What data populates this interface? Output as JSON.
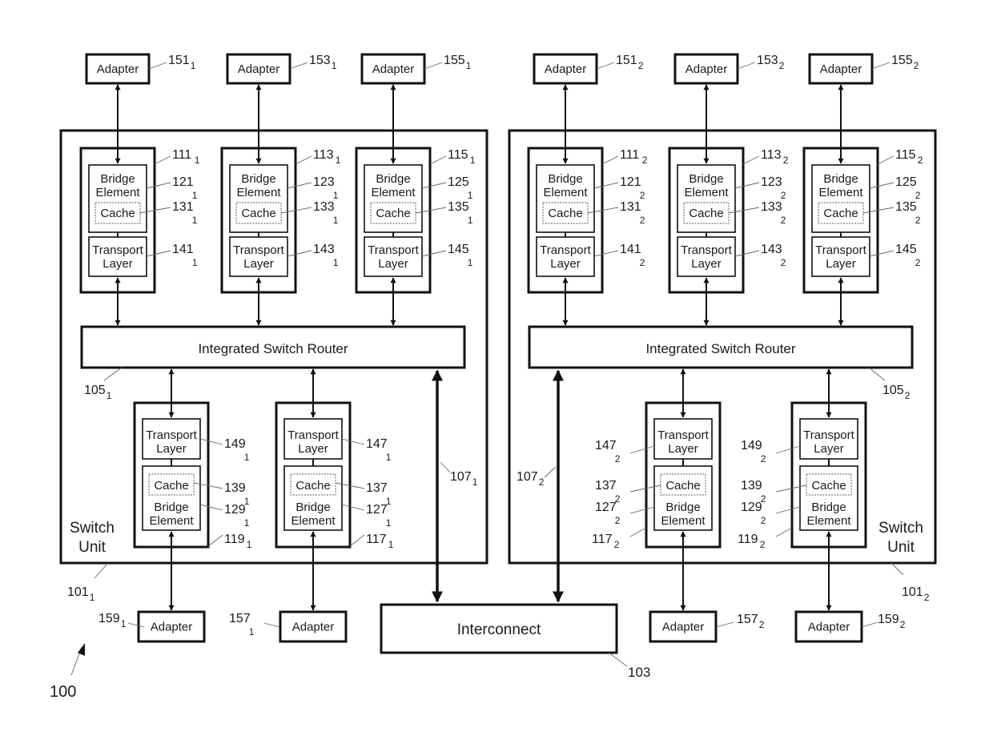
{
  "figure": {
    "figure_number": "100",
    "interconnect": {
      "label": "Interconnect",
      "ref": "103"
    },
    "switch_units": [
      {
        "id": "1",
        "label_line1": "Switch",
        "label_line2": "Unit",
        "ref": "101",
        "ref_sub": "1",
        "router": {
          "label": "Integrated Switch Router",
          "ref": "105",
          "ref_sub": "1"
        },
        "interconnect_link": {
          "ref": "107",
          "ref_sub": "1"
        },
        "top_modules": [
          {
            "module_ref": "111",
            "bridge_ref": "121",
            "cache_ref": "131",
            "transport_ref": "141",
            "adapter_ref": "151",
            "sub": "1"
          },
          {
            "module_ref": "113",
            "bridge_ref": "123",
            "cache_ref": "133",
            "transport_ref": "143",
            "adapter_ref": "153",
            "sub": "1"
          },
          {
            "module_ref": "115",
            "bridge_ref": "125",
            "cache_ref": "135",
            "transport_ref": "145",
            "adapter_ref": "155",
            "sub": "1"
          }
        ],
        "bottom_modules": [
          {
            "module_ref": "119",
            "bridge_ref": "129",
            "cache_ref": "139",
            "transport_ref": "149",
            "adapter_ref": "159",
            "sub": "1"
          },
          {
            "module_ref": "117",
            "bridge_ref": "127",
            "cache_ref": "137",
            "transport_ref": "147",
            "adapter_ref": "157",
            "sub": "1"
          }
        ]
      },
      {
        "id": "2",
        "label_line1": "Switch",
        "label_line2": "Unit",
        "ref": "101",
        "ref_sub": "2",
        "router": {
          "label": "Integrated Switch Router",
          "ref": "105",
          "ref_sub": "2"
        },
        "interconnect_link": {
          "ref": "107",
          "ref_sub": "2"
        },
        "top_modules": [
          {
            "module_ref": "111",
            "bridge_ref": "121",
            "cache_ref": "131",
            "transport_ref": "141",
            "adapter_ref": "151",
            "sub": "2"
          },
          {
            "module_ref": "113",
            "bridge_ref": "123",
            "cache_ref": "133",
            "transport_ref": "143",
            "adapter_ref": "153",
            "sub": "2"
          },
          {
            "module_ref": "115",
            "bridge_ref": "125",
            "cache_ref": "135",
            "transport_ref": "145",
            "adapter_ref": "155",
            "sub": "2"
          }
        ],
        "bottom_modules": [
          {
            "module_ref": "117",
            "bridge_ref": "127",
            "cache_ref": "137",
            "transport_ref": "147",
            "adapter_ref": "157",
            "sub": "2"
          },
          {
            "module_ref": "119",
            "bridge_ref": "129",
            "cache_ref": "139",
            "transport_ref": "149",
            "adapter_ref": "159",
            "sub": "2"
          }
        ]
      }
    ],
    "labels": {
      "adapter": "Adapter",
      "bridge_line1": "Bridge",
      "bridge_line2": "Element",
      "cache": "Cache",
      "transport_line1": "Transport",
      "transport_line2": "Layer"
    }
  }
}
